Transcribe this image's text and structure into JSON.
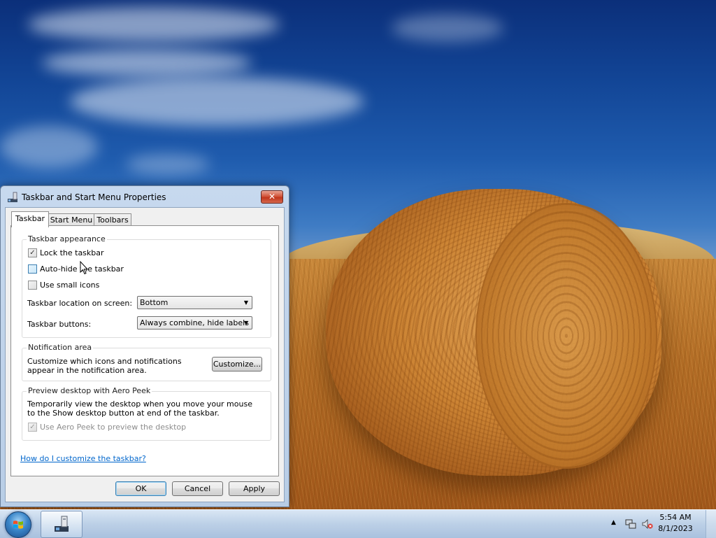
{
  "dialog": {
    "title": "Taskbar and Start Menu Properties",
    "close_label": "✕",
    "tabs": [
      {
        "label": "Taskbar"
      },
      {
        "label": "Start Menu"
      },
      {
        "label": "Toolbars"
      }
    ],
    "appearance": {
      "title": "Taskbar appearance",
      "lock_label": "Lock the taskbar",
      "lock_checked": true,
      "autohide_label": "Auto-hide the taskbar",
      "autohide_checked": false,
      "small_icons_label": "Use small icons",
      "small_icons_checked": false,
      "location_label": "Taskbar location on screen:",
      "location_value": "Bottom",
      "buttons_label": "Taskbar buttons:",
      "buttons_value": "Always combine, hide labels"
    },
    "notification": {
      "title": "Notification area",
      "text": "Customize which icons and notifications appear in the notification area.",
      "customize_label": "Customize..."
    },
    "aero_peek": {
      "title": "Preview desktop with Aero Peek",
      "text": "Temporarily view the desktop when you move your mouse to the Show desktop button at end of the taskbar.",
      "checkbox_label": "Use Aero Peek to preview the desktop",
      "checked": true
    },
    "help_link": "How do I customize the taskbar?",
    "ok_label": "OK",
    "cancel_label": "Cancel",
    "apply_label": "Apply"
  },
  "taskbar": {
    "time": "5:54 AM",
    "date": "8/1/2023"
  },
  "colors": {
    "link": "#0066cc",
    "close_button": "#c1361c",
    "taskbar": "#bcd0e7"
  }
}
